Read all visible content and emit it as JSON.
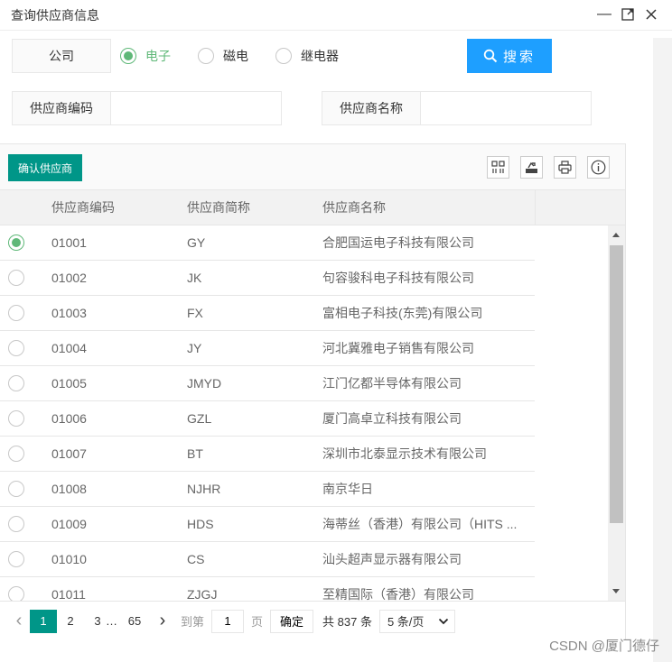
{
  "window": {
    "title": "查询供应商信息",
    "controls": {
      "minimize": "—",
      "maximize": "⤢",
      "close": "✕"
    }
  },
  "filter": {
    "company_label": "公司",
    "options": [
      {
        "label": "电子",
        "checked": true
      },
      {
        "label": "磁电",
        "checked": false
      },
      {
        "label": "继电器",
        "checked": false
      }
    ],
    "search_label": "搜索",
    "code_label": "供应商编码",
    "code_value": "",
    "name_label": "供应商名称",
    "name_value": ""
  },
  "toolbar": {
    "confirm_label": "确认供应商",
    "icons": [
      "columns-filter-icon",
      "export-icon",
      "print-icon",
      "info-icon"
    ]
  },
  "table": {
    "headers": [
      "供应商编码",
      "供应商简称",
      "供应商名称"
    ],
    "rows": [
      {
        "code": "01001",
        "short": "GY",
        "name": "合肥国运电子科技有限公司",
        "selected": true
      },
      {
        "code": "01002",
        "short": "JK",
        "name": "句容骏科电子科技有限公司",
        "selected": false
      },
      {
        "code": "01003",
        "short": "FX",
        "name": "富相电子科技(东莞)有限公司",
        "selected": false
      },
      {
        "code": "01004",
        "short": "JY",
        "name": "河北冀雅电子销售有限公司",
        "selected": false
      },
      {
        "code": "01005",
        "short": "JMYD",
        "name": "江门亿都半导体有限公司",
        "selected": false
      },
      {
        "code": "01006",
        "short": "GZL",
        "name": "厦门高卓立科技有限公司",
        "selected": false
      },
      {
        "code": "01007",
        "short": "BT",
        "name": "深圳市北泰显示技术有限公司",
        "selected": false
      },
      {
        "code": "01008",
        "short": "NJHR",
        "name": "南京华日",
        "selected": false
      },
      {
        "code": "01009",
        "short": "HDS",
        "name": "海蒂丝（香港）有限公司（HITS ...",
        "selected": false
      },
      {
        "code": "01010",
        "short": "CS",
        "name": "汕头超声显示器有限公司",
        "selected": false
      },
      {
        "code": "01011",
        "short": "ZJGJ",
        "name": "至精国际（香港）有限公司",
        "selected": false
      }
    ]
  },
  "pager": {
    "prev": "‹",
    "pages": [
      "1",
      "2",
      "3"
    ],
    "ellipsis": "…",
    "last_page": "65",
    "next": "›",
    "goto_label": "到第",
    "goto_value": "1",
    "page_unit": "页",
    "confirm": "确定",
    "total": "共 837 条",
    "page_size": "5 条/页"
  },
  "watermark": "CSDN @厦门德仔",
  "colors": {
    "primary": "#009688",
    "search": "#1e9fff",
    "radio": "#5fb878"
  }
}
